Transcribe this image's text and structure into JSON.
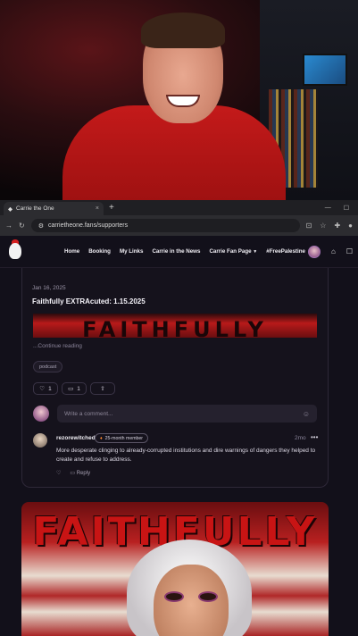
{
  "browser": {
    "tab_title": "Carrie the One",
    "tab_close": "×",
    "new_tab": "+",
    "url": "carrietheone.fans/supporters"
  },
  "site": {
    "nav": [
      "Home",
      "Booking",
      "My Links",
      "Carrie in the News",
      "Carrie Fan Page",
      "#FreePalestine"
    ],
    "nav_caret_item": "Carrie Fan Page"
  },
  "post": {
    "date": "Jan 16, 2025",
    "title": "Faithfully EXTRAcuted: 1.15.2025",
    "banner_text": "FAITHFULLY",
    "continue": "...Continue reading",
    "tag": "podcast",
    "likes": "1",
    "comments": "1"
  },
  "comment_box": {
    "placeholder": "Write a comment..."
  },
  "comment": {
    "author": "rezorewitched",
    "badge": "25-month member",
    "time": "2mo",
    "body": "More desperate clinging to already-corrupted institutions and dire warnings of dangers they helped to create and refuse to address.",
    "reply": "Reply"
  },
  "poster": {
    "text": "FAITHFULLY"
  },
  "colors": {
    "page_bg": "#12101a",
    "accent_red": "#c81414"
  }
}
